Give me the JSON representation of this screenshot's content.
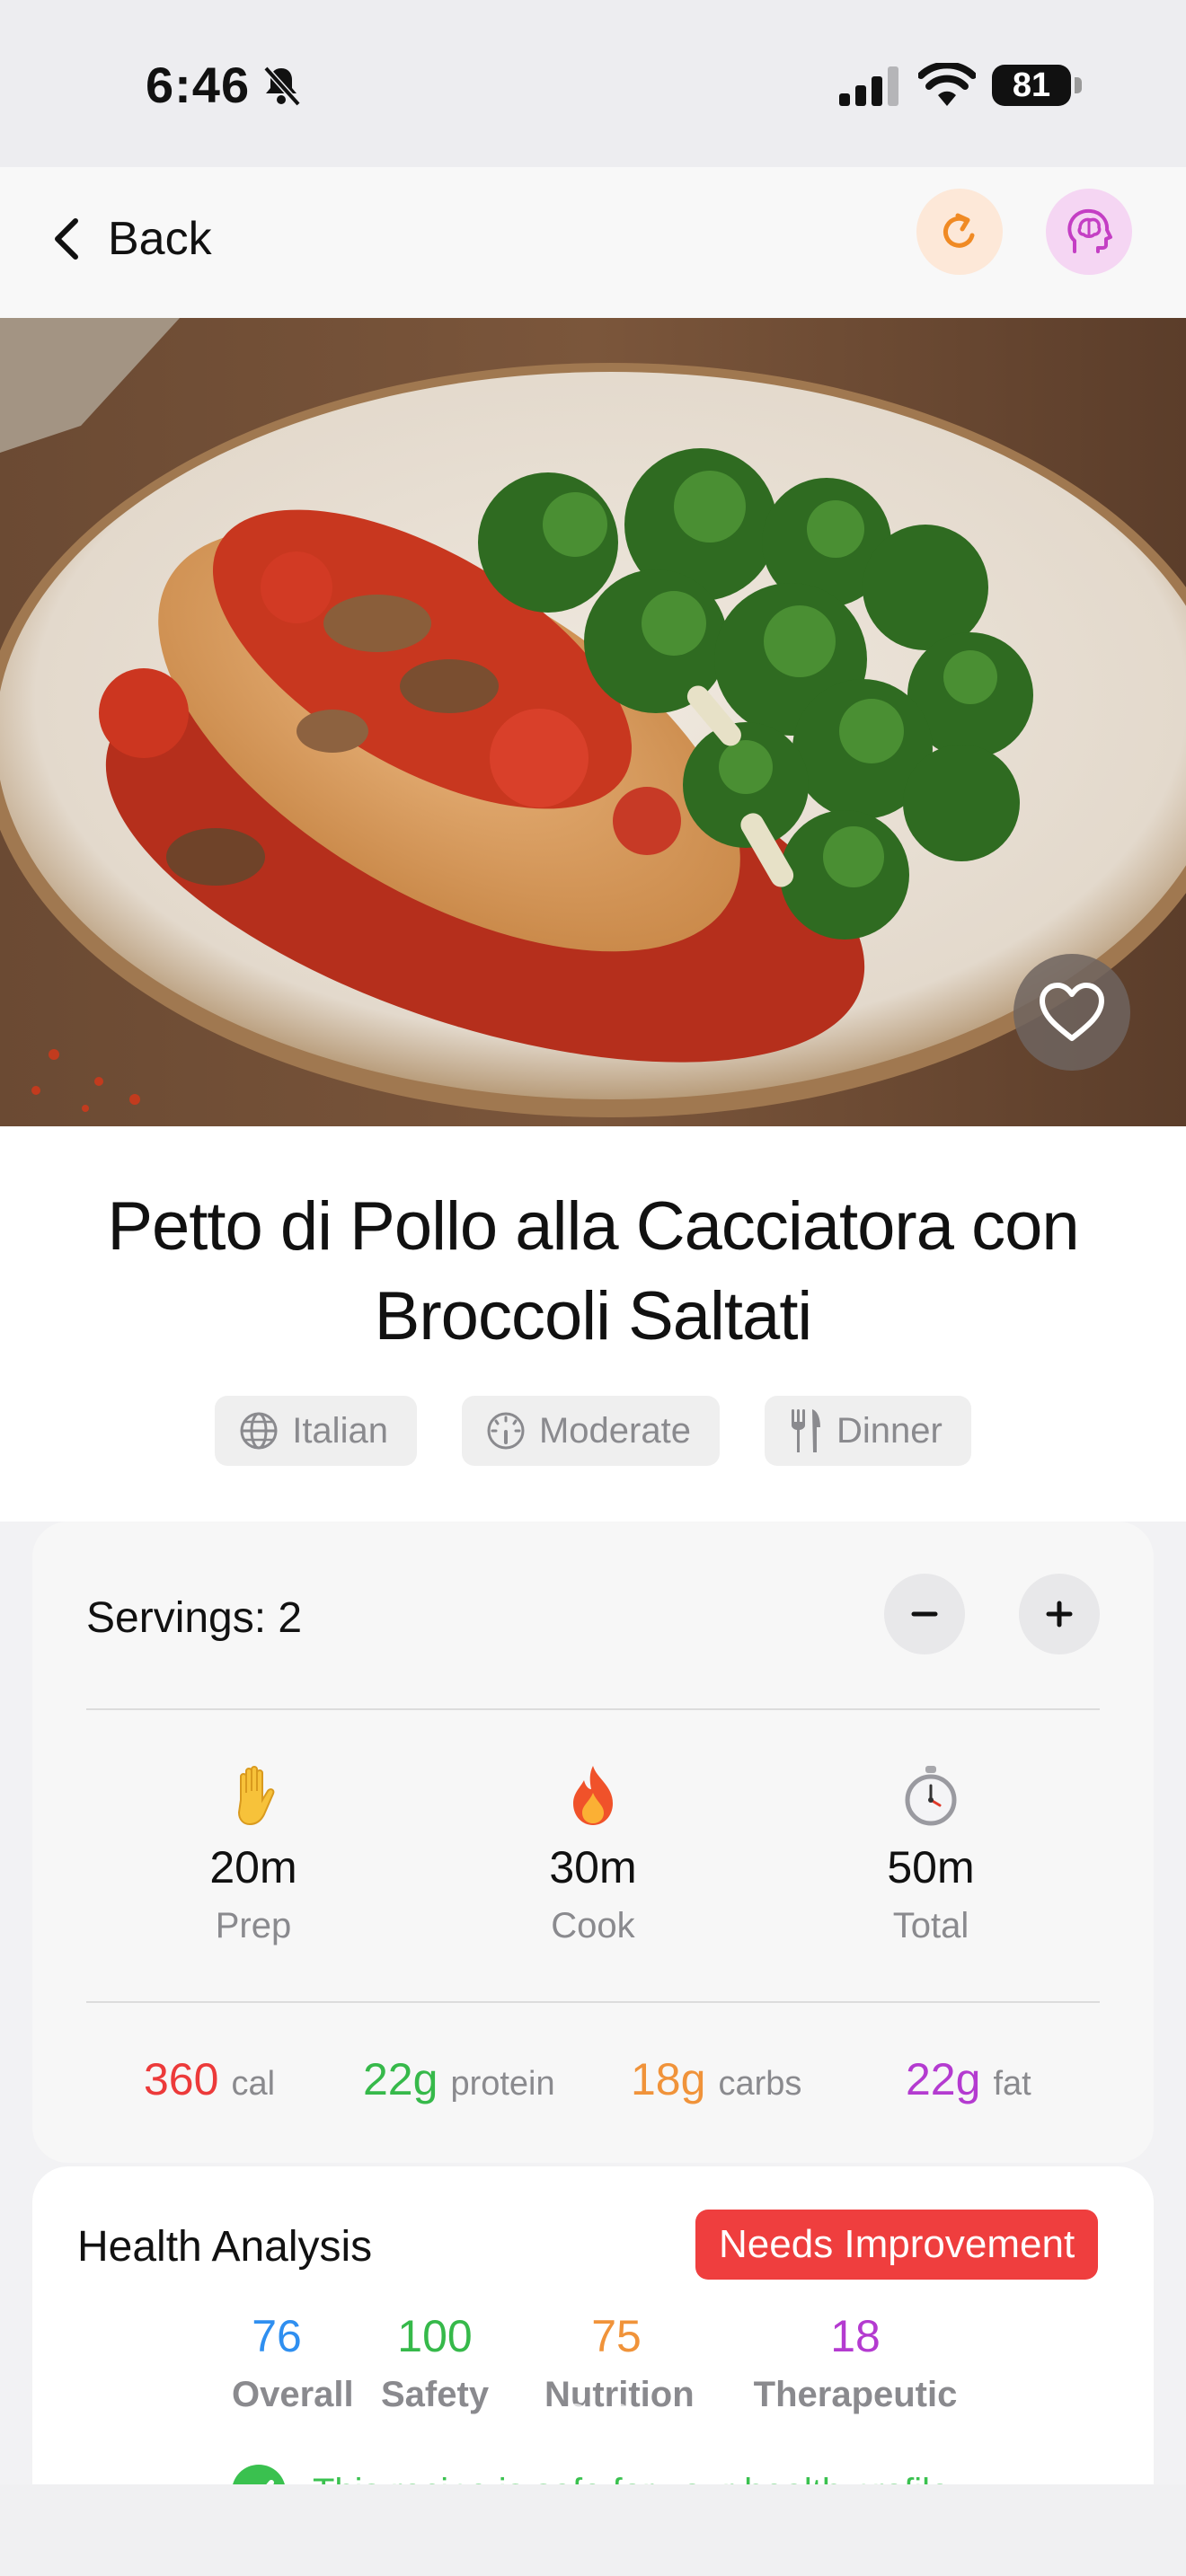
{
  "status_bar": {
    "time": "6:46",
    "battery": "81"
  },
  "nav": {
    "back_label": "Back"
  },
  "recipe": {
    "title": "Petto di Pollo alla Cacciatora con Broccoli Saltati",
    "tags": [
      {
        "icon": "globe-icon",
        "label": "Italian"
      },
      {
        "icon": "gauge-icon",
        "label": "Moderate"
      },
      {
        "icon": "fork-knife-icon",
        "label": "Dinner"
      }
    ]
  },
  "servings": {
    "label": "Servings: 2",
    "minus": "−",
    "plus": "+"
  },
  "times": [
    {
      "icon": "hand-emoji-icon",
      "value": "20m",
      "label": "Prep"
    },
    {
      "icon": "fire-emoji-icon",
      "value": "30m",
      "label": "Cook"
    },
    {
      "icon": "stopwatch-emoji-icon",
      "value": "50m",
      "label": "Total"
    }
  ],
  "macros": [
    {
      "value": "360",
      "unit": "cal",
      "color": "#ec3a3a"
    },
    {
      "value": "22g",
      "unit": "protein",
      "color": "#36b94a"
    },
    {
      "value": "18g",
      "unit": "carbs",
      "color": "#f0933a"
    },
    {
      "value": "22g",
      "unit": "fat",
      "color": "#b43bd0"
    }
  ],
  "health": {
    "title": "Health Analysis",
    "badge": "Needs Improvement",
    "badge_color": "#ef3e3e",
    "scores": [
      {
        "value": "76",
        "label": "Overall",
        "color": "#2f8ff0"
      },
      {
        "value": "100",
        "label": "Safety",
        "color": "#36b94a"
      },
      {
        "value": "75",
        "label": "Nutrition",
        "color": "#f0933a"
      },
      {
        "value": "18",
        "label": "Therapeutic",
        "color": "#b43bd0"
      }
    ],
    "safe_message": "This recipe is safe for your health profile"
  }
}
